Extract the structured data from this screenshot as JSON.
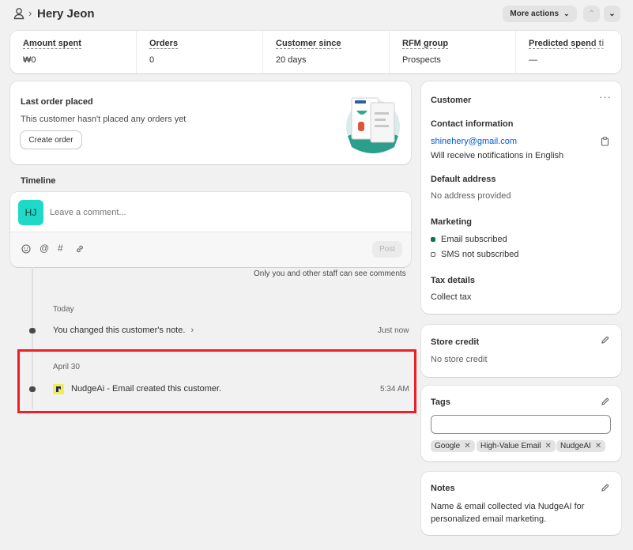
{
  "header": {
    "title": "Hery Jeon",
    "more_actions_label": "More actions"
  },
  "stats": [
    {
      "label": "Amount spent",
      "value": "₩0"
    },
    {
      "label": "Orders",
      "value": "0"
    },
    {
      "label": "Customer since",
      "value": "20 days"
    },
    {
      "label": "RFM group",
      "value": "Prospects"
    },
    {
      "label": "Predicted spend ti",
      "value": "—"
    }
  ],
  "last_order": {
    "title": "Last order placed",
    "text": "This customer hasn't placed any orders yet",
    "button_label": "Create order"
  },
  "timeline": {
    "title": "Timeline",
    "avatar_initials": "HJ",
    "comment_placeholder": "Leave a comment...",
    "post_label": "Post",
    "staff_note": "Only you and other staff can see comments",
    "groups": [
      {
        "date": "Today",
        "event": "You changed this customer's note.",
        "time": "Just now"
      },
      {
        "date": "April 30",
        "event": "NudgeAi - Email created this customer.",
        "time": "5:34 AM"
      }
    ]
  },
  "customer": {
    "title": "Customer",
    "contact_heading": "Contact information",
    "email": "shinehery@gmail.com",
    "notification_text": "Will receive notifications in English",
    "address_heading": "Default address",
    "address_text": "No address provided",
    "marketing_heading": "Marketing",
    "email_status": "Email subscribed",
    "sms_status": "SMS not subscribed",
    "tax_heading": "Tax details",
    "tax_text": "Collect tax"
  },
  "store_credit": {
    "title": "Store credit",
    "text": "No store credit"
  },
  "tags": {
    "title": "Tags",
    "input_value": "",
    "items": [
      "Google",
      "High-Value Email",
      "NudgeAI"
    ]
  },
  "notes": {
    "title": "Notes",
    "text": "Name & email collected via NudgeAI for personalized email marketing."
  },
  "colors": {
    "avatar_bg": "#1ed8c8",
    "link": "#005bd3",
    "highlight": "#e8202a",
    "subscribed": "#047b5d"
  }
}
